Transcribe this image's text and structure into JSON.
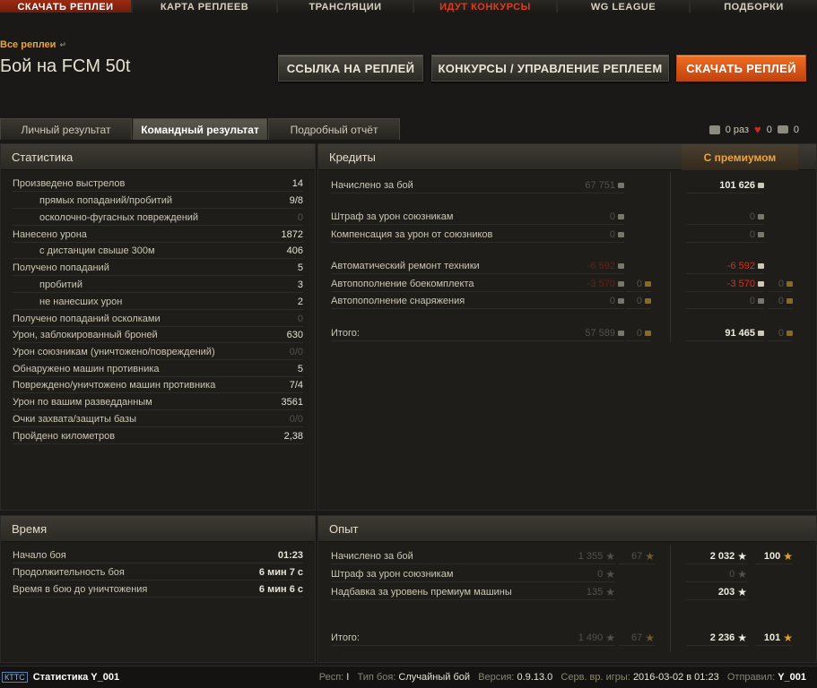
{
  "topnav": [
    {
      "label": "Скачать реплеи",
      "state": "active"
    },
    {
      "label": "Карта реплеев",
      "state": ""
    },
    {
      "label": "Трансляции",
      "state": ""
    },
    {
      "label": "Идут конкурсы",
      "state": "red"
    },
    {
      "label": "WG League",
      "state": ""
    },
    {
      "label": "Подборки",
      "state": ""
    }
  ],
  "header": {
    "breadcrumb": "Все реплеи",
    "title": "Бой на FCM 50t",
    "btn_link": "ССЫЛКА НА РЕПЛЕЙ",
    "btn_contests": "КОНКУРСЫ / УПРАВЛЕНИЕ РЕПЛЕЕМ",
    "btn_download": "СКАЧАТЬ РЕПЛЕЙ"
  },
  "tabs": [
    "Личный результат",
    "Командный результат",
    "Подробный отчёт"
  ],
  "counters": {
    "views": "0 раз",
    "likes": "0",
    "comments": "0"
  },
  "stats": {
    "title": "Статистика",
    "rows": [
      {
        "label": "Произведено выстрелов",
        "value": "14"
      },
      {
        "label": "прямых попаданий/пробитий",
        "value": "9/8"
      },
      {
        "label": "осколочно-фугасных повреждений",
        "value": "0"
      },
      {
        "label": "Нанесено урона",
        "value": "1872"
      },
      {
        "label": "с дистанции свыше 300м",
        "value": "406"
      },
      {
        "label": "Получено попаданий",
        "value": "5"
      },
      {
        "label": "пробитий",
        "value": "3"
      },
      {
        "label": "не нанесших урон",
        "value": "2"
      },
      {
        "label": "Получено попаданий осколками",
        "value": "0"
      },
      {
        "label": "Урон, заблокированный броней",
        "value": "630"
      },
      {
        "label": "Урон союзникам (уничтожено/повреждений)",
        "value": "0/0"
      },
      {
        "label": "Обнаружено машин противника",
        "value": "5"
      },
      {
        "label": "Повреждено/уничтожено машин противника",
        "value": "7/4"
      },
      {
        "label": "Урон по вашим разведданным",
        "value": "3561"
      },
      {
        "label": "Очки захвата/защиты базы",
        "value": "0/0"
      },
      {
        "label": "Пройдено километров",
        "value": "2,38"
      }
    ]
  },
  "credits": {
    "title": "Кредиты",
    "premium": "С премиумом",
    "rows": [
      {
        "label": "Начислено за бой",
        "base": "67 751",
        "base_gold": "",
        "prem": "101 626",
        "prem_gold": ""
      },
      {
        "label": "Штраф за урон союзникам",
        "base": "0",
        "base_gold": "",
        "prem": "0",
        "prem_gold": ""
      },
      {
        "label": "Компенсация за урон от союзников",
        "base": "0",
        "base_gold": "",
        "prem": "0",
        "prem_gold": ""
      },
      {
        "label": "Автоматический ремонт техники",
        "base": "-6 592",
        "base_gold": "",
        "prem": "-6 592",
        "prem_gold": ""
      },
      {
        "label": "Автопополнение боекомплекта",
        "base": "-3 570",
        "base_gold": "0",
        "prem": "-3 570",
        "prem_gold": "0"
      },
      {
        "label": "Автопополнение снаряжения",
        "base": "0",
        "base_gold": "0",
        "prem": "0",
        "prem_gold": "0"
      },
      {
        "label": "Итого:",
        "base": "57 589",
        "base_gold": "0",
        "prem": "91 465",
        "prem_gold": "0"
      }
    ]
  },
  "time": {
    "title": "Время",
    "rows": [
      {
        "label": "Начало боя",
        "value": "01:23"
      },
      {
        "label": "Продолжительность боя",
        "value": "6 мин 7 с"
      },
      {
        "label": "Время в бою до уничтожения",
        "value": "6 мин 6 с"
      }
    ]
  },
  "exp": {
    "title": "Опыт",
    "rows": [
      {
        "label": "Начислено за бой",
        "base": "1 355",
        "base_free": "67",
        "prem": "2 032",
        "prem_free": "100"
      },
      {
        "label": "Штраф за урон союзникам",
        "base": "0",
        "base_free": "",
        "prem": "0",
        "prem_free": ""
      },
      {
        "label": "Надбавка за уровень премиум машины",
        "base": "135",
        "base_free": "",
        "prem": "203",
        "prem_free": ""
      },
      {
        "label": "Итого:",
        "base": "1 490",
        "base_free": "67",
        "prem": "2 236",
        "prem_free": "101"
      }
    ]
  },
  "footer": {
    "badge": "КТТС",
    "stat_user": "Статистика Y_001",
    "resp_label": "Респ:",
    "resp_value": "I",
    "battle_type_label": "Тип боя:",
    "battle_type": "Случайный бой",
    "version_label": "Версия:",
    "version": "0.9.13.0",
    "server_time_label": "Серв. вр. игры:",
    "server_time": "2016-03-02 в 01:23",
    "sender_label": "Отправил:",
    "sender": "Y_001"
  }
}
